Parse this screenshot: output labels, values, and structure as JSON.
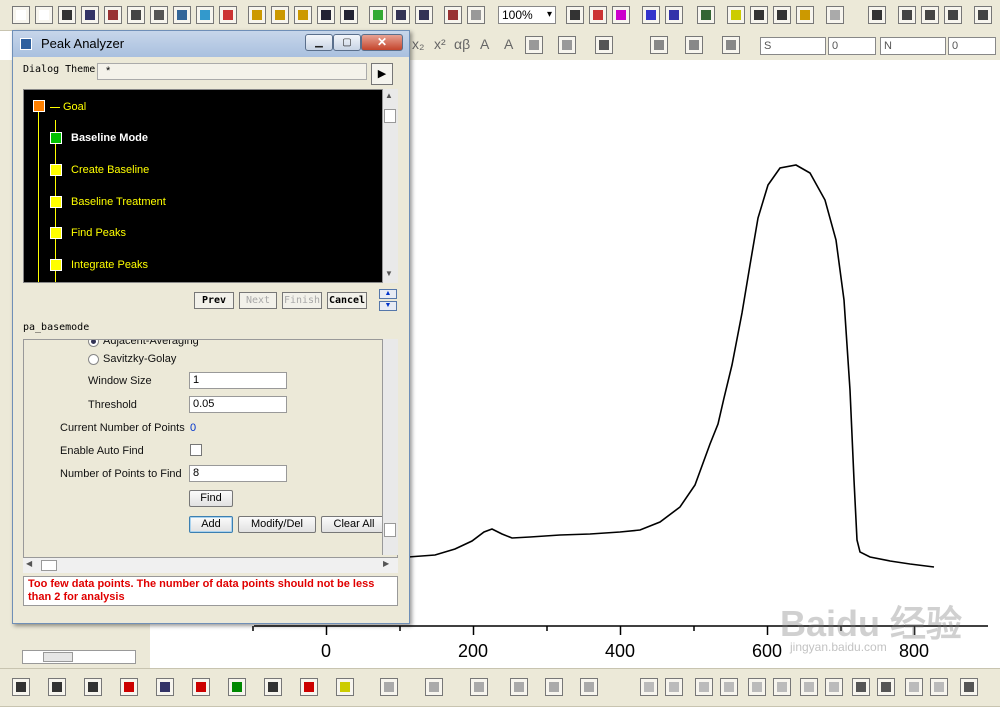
{
  "toolbar": {
    "zoom": "100%",
    "format_glyphs": [
      "x₂",
      "x²",
      "αβ",
      "A",
      "A"
    ],
    "line_style_combo": "S",
    "line_width_combo": "0",
    "border_combo": "N",
    "border_width_combo": "0"
  },
  "dialog": {
    "title": "Peak Analyzer",
    "theme_label": "Dialog Theme",
    "theme_value": "*",
    "tree": [
      {
        "label": "Goal",
        "color": "#ff8000",
        "current": false
      },
      {
        "label": "Baseline Mode",
        "color": "#00c000",
        "current": true
      },
      {
        "label": "Create Baseline",
        "color": "#ffff00",
        "current": false
      },
      {
        "label": "Baseline Treatment",
        "color": "#ffff00",
        "current": false
      },
      {
        "label": "Find Peaks",
        "color": "#ffff00",
        "current": false
      },
      {
        "label": "Integrate Peaks",
        "color": "#ffff00",
        "current": false
      }
    ],
    "buttons": {
      "prev": "Prev",
      "next": "Next",
      "finish": "Finish",
      "cancel": "Cancel"
    },
    "section_name": "pa_basemode",
    "settings": {
      "radio_1": "Adjacent-Averaging",
      "radio_2": "Savitzky-Golay",
      "window_size_label": "Window Size",
      "window_size_value": "1",
      "threshold_label": "Threshold",
      "threshold_value": "0.05",
      "current_points_label": "Current Number of Points",
      "current_points_value": "0",
      "auto_find_label": "Enable Auto Find",
      "points_to_find_label": "Number of Points to Find",
      "points_to_find_value": "8",
      "find_button": "Find",
      "add_button": "Add",
      "modify_button": "Modify/Del",
      "clear_button": "Clear All"
    },
    "message": "Too few data points. The number of data points should not be less than 2 for analysis"
  },
  "plot": {
    "x_tick_labels": [
      "0",
      "200",
      "400",
      "600",
      "800"
    ]
  },
  "watermark": {
    "brand": "Baidu 经验",
    "url": "jingyan.baidu.com"
  },
  "colors": {
    "message_text": "#e00000",
    "current_points_value": "#0033cc"
  }
}
